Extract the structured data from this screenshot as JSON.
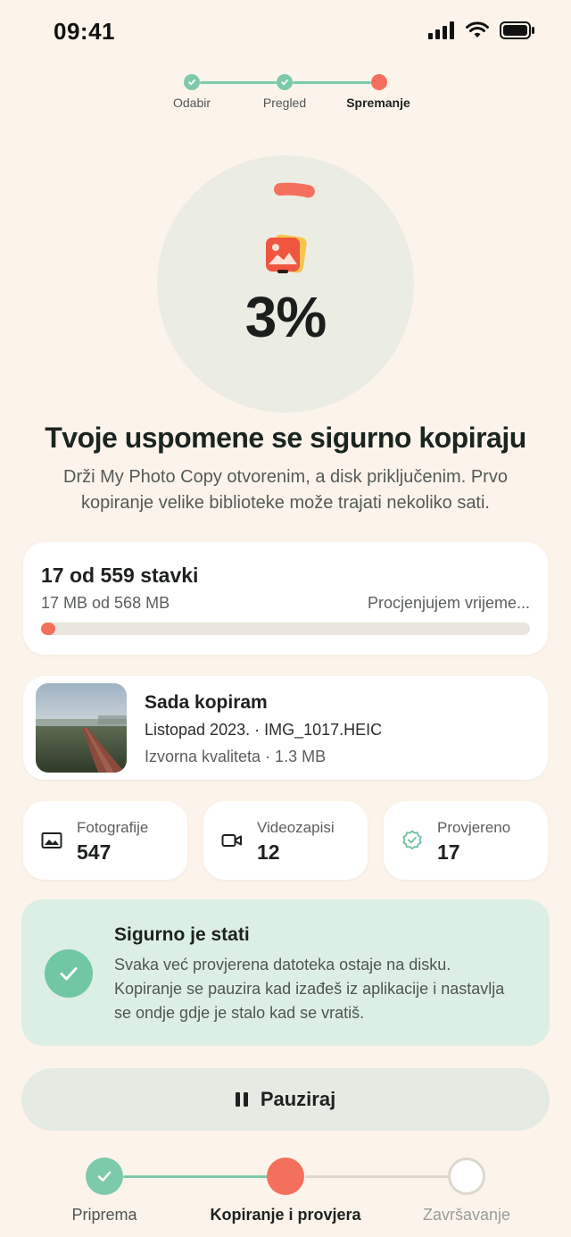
{
  "status_bar": {
    "time": "09:41",
    "icons": [
      "signal-icon",
      "wifi-icon",
      "battery-icon"
    ]
  },
  "top_stepper": {
    "steps": [
      {
        "label": "Odabir",
        "state": "done"
      },
      {
        "label": "Pregled",
        "state": "done"
      },
      {
        "label": "Spremanje",
        "state": "active"
      }
    ]
  },
  "progress": {
    "percent_text": "3%",
    "fraction": 0.03,
    "icon": "photo-stack-icon"
  },
  "headline": "Tvoje uspomene se sigurno kopiraju",
  "subtext": "Drži My Photo Copy otvorenim, a disk priključenim. Prvo kopiranje velike biblioteke može trajati nekoliko sati.",
  "progress_card": {
    "items_text": "17 od 559 stavki",
    "size_text": "17 MB od 568 MB",
    "eta_text": "Procjenjujem vrijeme...",
    "bar_fraction": 0.03
  },
  "now_copying": {
    "title": "Sada kopiram",
    "file": "Listopad 2023. · IMG_1017.HEIC",
    "quality": "Izvorna kvaliteta · 1.3 MB"
  },
  "stats": [
    {
      "label": "Fotografije",
      "value": "547",
      "icon": "image-icon"
    },
    {
      "label": "Videozapisi",
      "value": "12",
      "icon": "video-icon"
    },
    {
      "label": "Provjereno",
      "value": "17",
      "icon": "verified-badge-icon"
    }
  ],
  "safe_notice": {
    "title": "Sigurno je stati",
    "text": "Svaka već provjerena datoteka ostaje na disku. Kopiranje se pauzira kad izađeš iz aplikacije i nastavlja se ondje gdje je stalo kad se vratiš."
  },
  "pause_button": {
    "label": "Pauziraj"
  },
  "bottom_stepper": {
    "steps": [
      {
        "label": "Priprema",
        "state": "done"
      },
      {
        "label": "Kopiranje i provjera",
        "state": "active"
      },
      {
        "label": "Završavanje",
        "state": "pending"
      }
    ]
  },
  "colors": {
    "background": "#fcf4ea",
    "accent_green": "#7ccaa9",
    "accent_coral": "#f5705c",
    "ring_track": "#ebece2",
    "safe_box": "#dcefe5"
  }
}
